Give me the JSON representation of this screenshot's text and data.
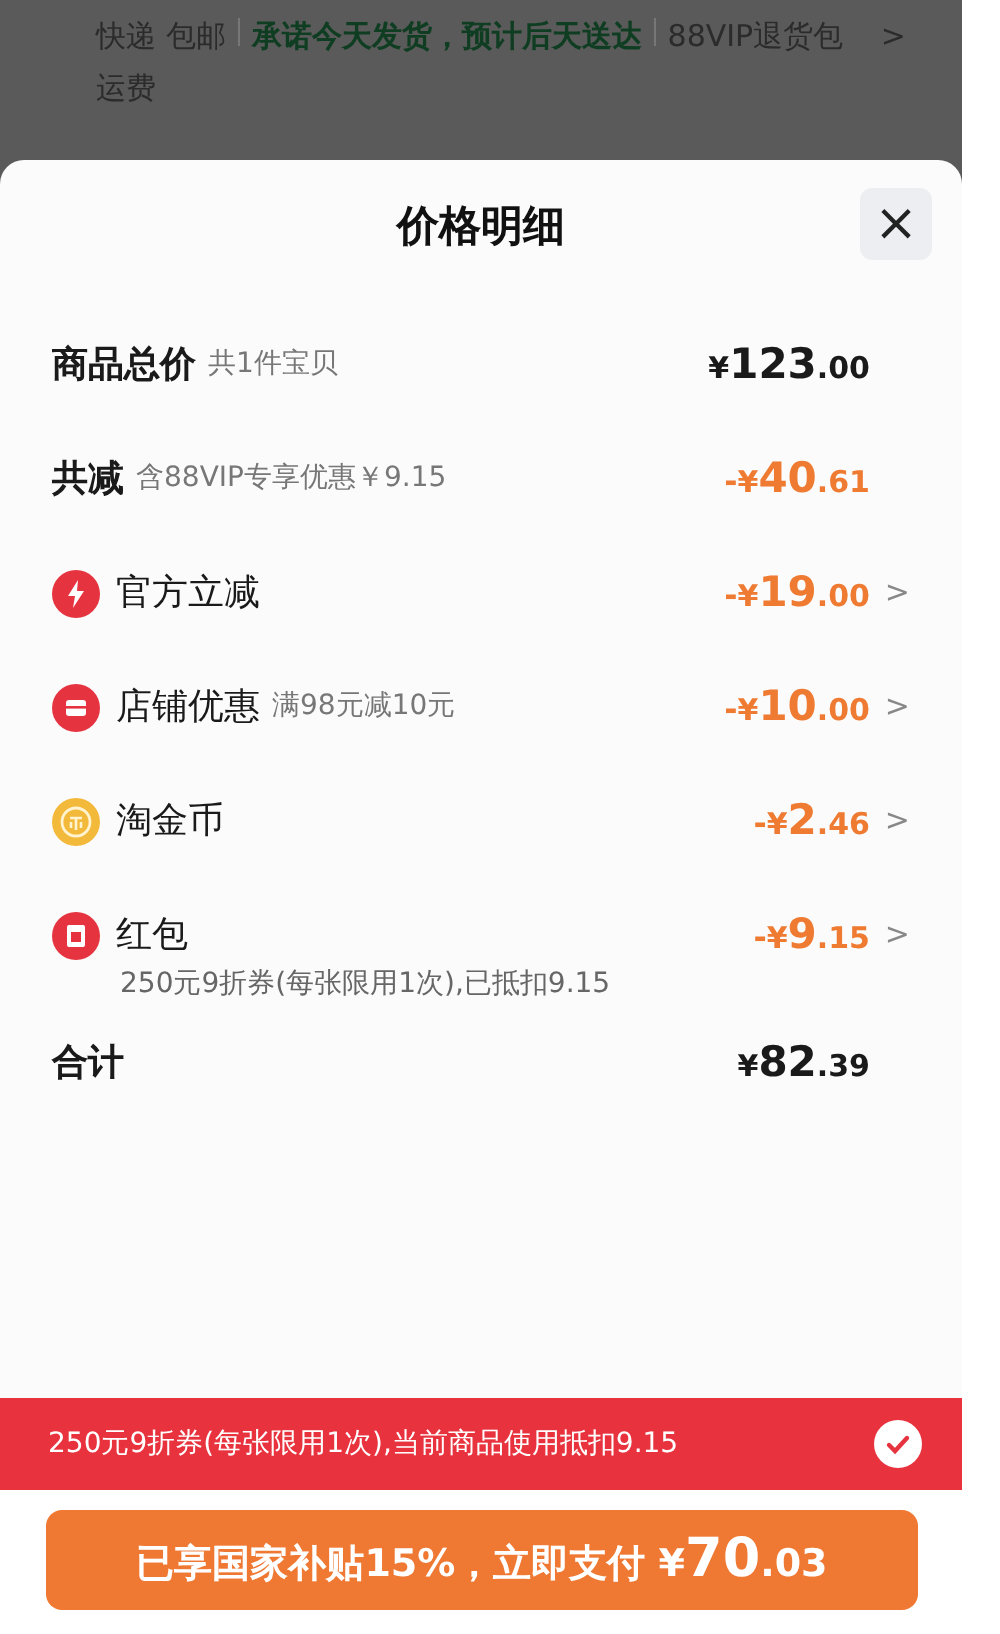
{
  "background": {
    "shipping": "快递 包邮",
    "promise": "承诺今天发货，预计后天送达",
    "vip": "88VIP退货包运费",
    "chevron": ">"
  },
  "sheet": {
    "title": "价格明细",
    "close": "×"
  },
  "rows": [
    {
      "kind": "summary",
      "label": "商品总价",
      "note": "共1件宝贝",
      "amount": {
        "currency": "¥",
        "main": "123",
        "cents": ".00"
      }
    },
    {
      "kind": "summary",
      "label": "共减",
      "note": "含88VIP专享优惠￥9.15",
      "amount": {
        "sign": "-",
        "currency": "¥",
        "main": "40",
        "cents": ".61"
      }
    },
    {
      "kind": "bolt",
      "label": "官方立减",
      "amount": {
        "sign": "-",
        "currency": "¥",
        "main": "19",
        "cents": ".00"
      },
      "chevron": ">"
    },
    {
      "kind": "shop",
      "label": "店铺优惠",
      "note": "满98元减10元",
      "amount": {
        "sign": "-",
        "currency": "¥",
        "main": "10",
        "cents": ".00"
      },
      "chevron": ">"
    },
    {
      "kind": "coin",
      "label": "淘金币",
      "amount": {
        "sign": "-",
        "currency": "¥",
        "main": "2",
        "cents": ".46"
      },
      "chevron": ">"
    },
    {
      "kind": "packet",
      "label": "红包",
      "detail": "250元9折券(每张限用1次),已抵扣9.15",
      "amount": {
        "sign": "-",
        "currency": "¥",
        "main": "9",
        "cents": ".15"
      },
      "chevron": ">"
    },
    {
      "kind": "summary",
      "label": "合计",
      "amount": {
        "currency": "¥",
        "main": "82",
        "cents": ".39"
      }
    }
  ],
  "coupon": {
    "text": "250元9折券(每张限用1次),当前商品使用抵扣9.15",
    "checked": true
  },
  "pay_button": {
    "label": "已享国家补贴15%，立即支付",
    "amount": {
      "currency": "¥",
      "main": "70",
      "cents": ".03"
    }
  }
}
